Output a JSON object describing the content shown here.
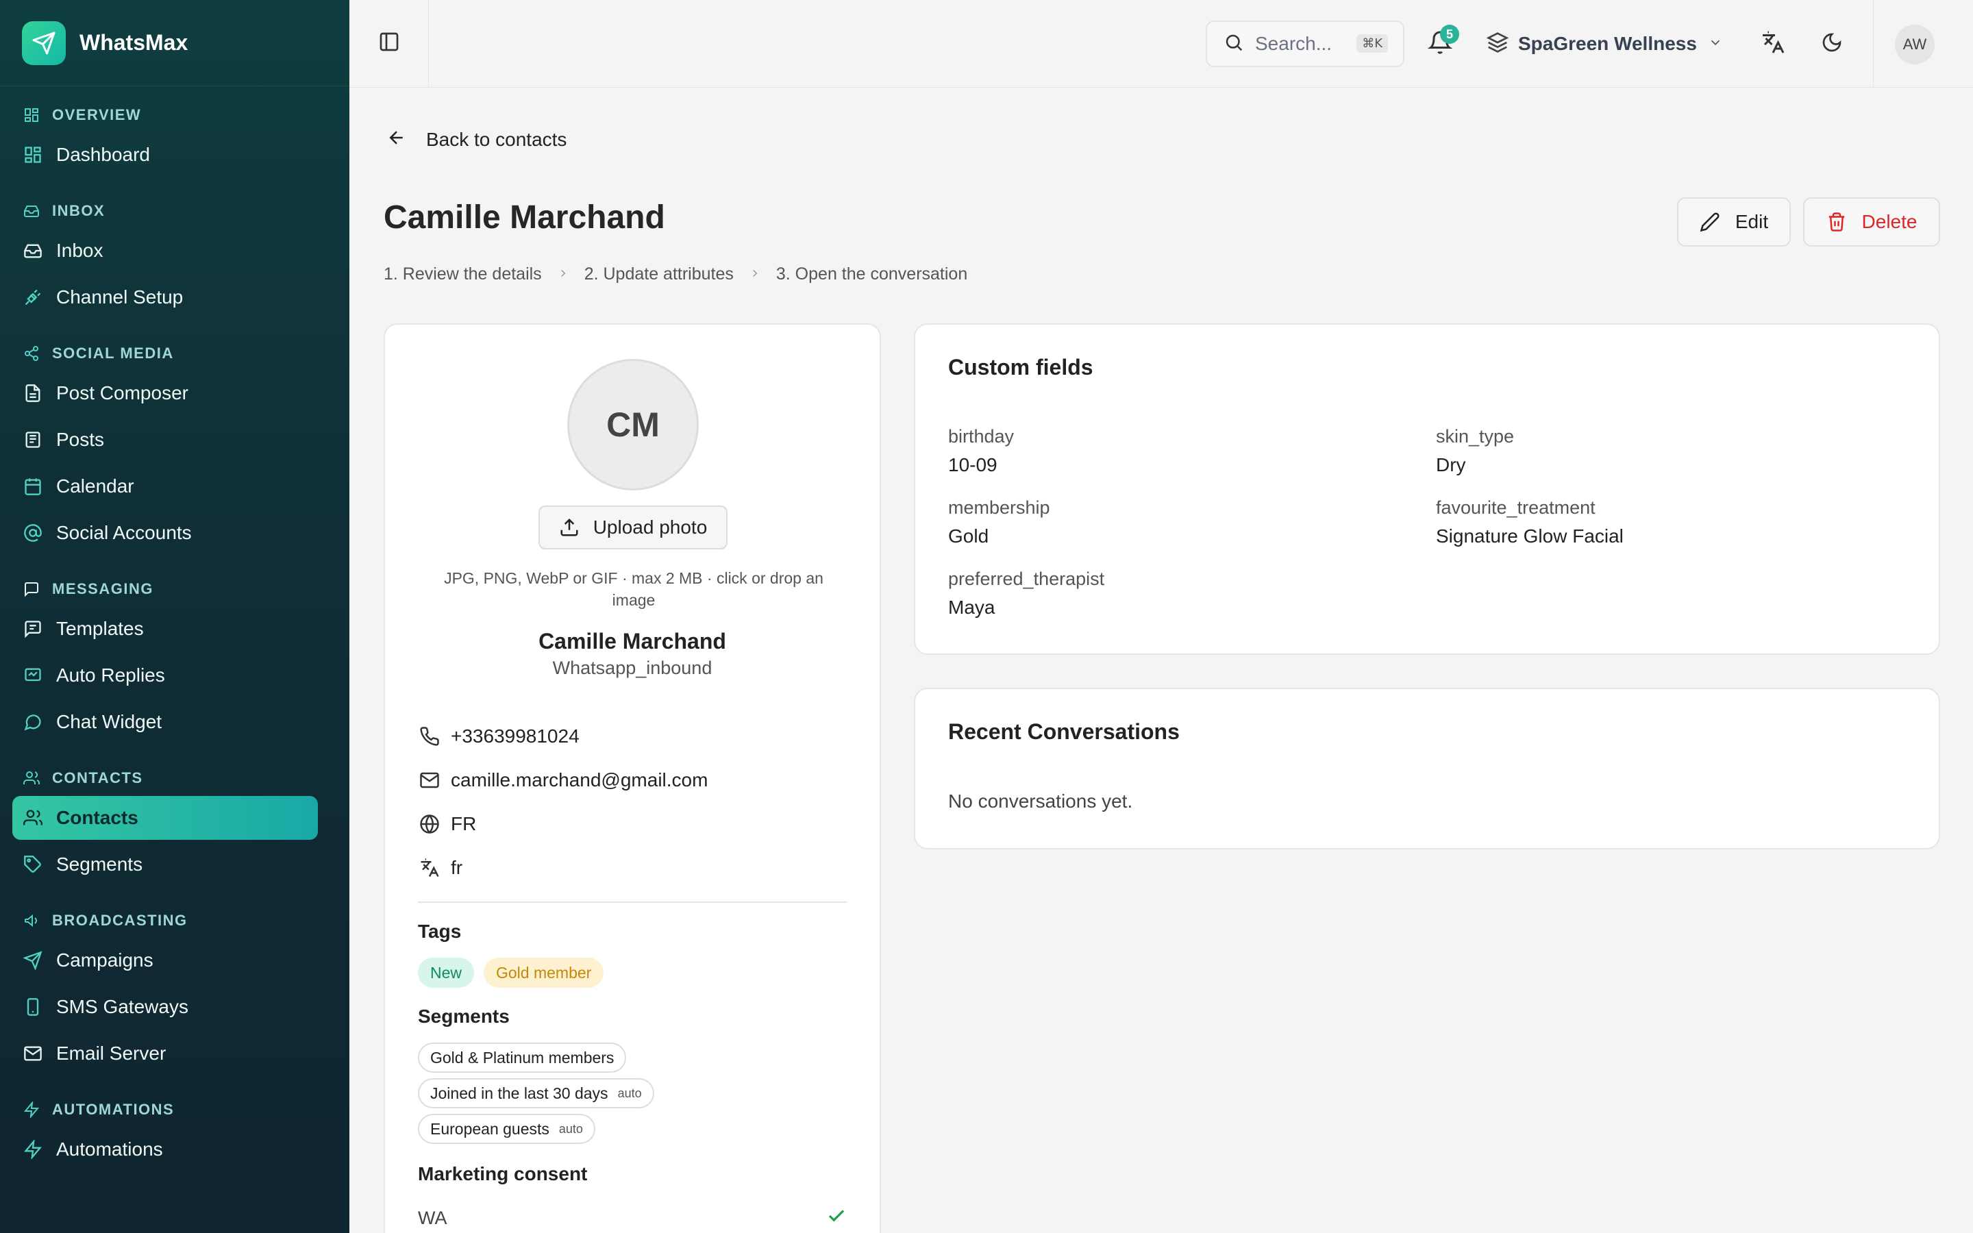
{
  "app": {
    "name": "WhatsMax"
  },
  "sidebar": {
    "sections": [
      {
        "label": "OVERVIEW",
        "icon": "grid-icon",
        "items": [
          {
            "label": "Dashboard",
            "icon": "dashboard-icon"
          }
        ]
      },
      {
        "label": "INBOX",
        "icon": "inbox-icon",
        "items": [
          {
            "label": "Inbox",
            "icon": "inbox-icon"
          },
          {
            "label": "Channel Setup",
            "icon": "plug-icon"
          }
        ]
      },
      {
        "label": "SOCIAL MEDIA",
        "icon": "share-icon",
        "items": [
          {
            "label": "Post Composer",
            "icon": "document-icon"
          },
          {
            "label": "Posts",
            "icon": "newspaper-icon"
          },
          {
            "label": "Calendar",
            "icon": "calendar-icon"
          },
          {
            "label": "Social Accounts",
            "icon": "at-icon"
          }
        ]
      },
      {
        "label": "MESSAGING",
        "icon": "message-square-icon",
        "items": [
          {
            "label": "Templates",
            "icon": "template-icon"
          },
          {
            "label": "Auto Replies",
            "icon": "reply-icon"
          },
          {
            "label": "Chat Widget",
            "icon": "chat-bubble-icon"
          }
        ]
      },
      {
        "label": "CONTACTS",
        "icon": "users-icon",
        "items": [
          {
            "label": "Contacts",
            "icon": "users-icon",
            "active": true
          },
          {
            "label": "Segments",
            "icon": "tag-icon"
          }
        ]
      },
      {
        "label": "BROADCASTING",
        "icon": "megaphone-icon",
        "items": [
          {
            "label": "Campaigns",
            "icon": "send-icon"
          },
          {
            "label": "SMS Gateways",
            "icon": "phone-device-icon"
          },
          {
            "label": "Email Server",
            "icon": "mail-icon"
          }
        ]
      },
      {
        "label": "AUTOMATIONS",
        "icon": "zap-icon",
        "items": [
          {
            "label": "Automations",
            "icon": "zap-icon"
          }
        ]
      }
    ]
  },
  "topbar": {
    "search_placeholder": "Search...",
    "search_shortcut": "⌘K",
    "notification_count": "5",
    "workspace": "SpaGreen Wellness",
    "user_initials": "AW"
  },
  "page": {
    "back_label": "Back to contacts",
    "title": "Camille Marchand",
    "edit_label": "Edit",
    "delete_label": "Delete",
    "steps": [
      "1.  Review the details",
      "2.  Update attributes",
      "3.  Open the conversation"
    ]
  },
  "profile": {
    "initials": "CM",
    "upload_label": "Upload photo",
    "upload_hint": "JPG, PNG, WebP or GIF · max 2 MB · click or drop an image",
    "name": "Camille Marchand",
    "source": "Whatsapp_inbound",
    "phone": "+33639981024",
    "email": "camille.marchand@gmail.com",
    "country": "FR",
    "language": "fr",
    "tags_heading": "Tags",
    "tags": [
      "New",
      "Gold member"
    ],
    "segments_heading": "Segments",
    "segments": [
      {
        "name": "Gold & Platinum members",
        "auto": ""
      },
      {
        "name": "Joined in the last 30 days",
        "auto": "auto"
      },
      {
        "name": "European guests",
        "auto": "auto"
      }
    ],
    "consent_heading": "Marketing consent",
    "consent": [
      {
        "channel": "WA",
        "granted": true
      }
    ]
  },
  "custom_fields": {
    "title": "Custom fields",
    "fields": [
      {
        "key": "birthday",
        "value": "10-09"
      },
      {
        "key": "skin_type",
        "value": "Dry"
      },
      {
        "key": "membership",
        "value": "Gold"
      },
      {
        "key": "favourite_treatment",
        "value": "Signature Glow Facial"
      },
      {
        "key": "preferred_therapist",
        "value": "Maya"
      }
    ]
  },
  "recent_conversations": {
    "title": "Recent Conversations",
    "empty": "No conversations yet."
  },
  "colors": {
    "accent": "#2bb39a",
    "sidebar_bg": "#0f3d3f",
    "danger": "#dc2626"
  }
}
